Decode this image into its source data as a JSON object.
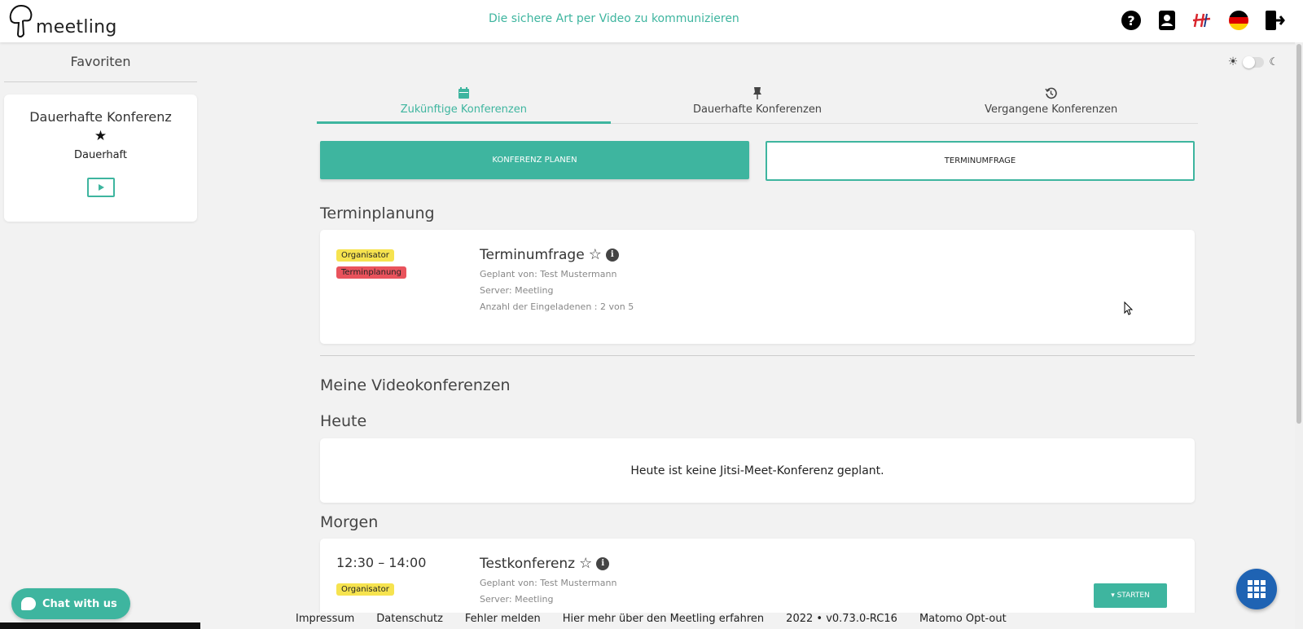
{
  "app": {
    "logo_text": "meetling",
    "tagline": "Die sichere Art per Video zu kommunizieren"
  },
  "header_icons": [
    "help-icon",
    "contacts-icon",
    "brand-icon",
    "german-flag-icon",
    "logout-icon"
  ],
  "sidebar": {
    "title": "Favoriten",
    "favorite": {
      "title": "Dauerhafte Konferenz",
      "subtitle": "Dauerhaft"
    }
  },
  "tabs": [
    {
      "label": "Zukünftige Konferenzen",
      "icon": "calendar-icon",
      "active": true
    },
    {
      "label": "Dauerhafte Konferenzen",
      "icon": "pin-icon",
      "active": false
    },
    {
      "label": "Vergangene Konferenzen",
      "icon": "history-icon",
      "active": false
    }
  ],
  "actions": {
    "plan_label": "KONFERENZ PLANEN",
    "poll_label": "TERMINUMFRAGE"
  },
  "scheduling": {
    "section_title": "Terminplanung",
    "card": {
      "badge_role": "Organisator",
      "badge_type": "Terminplanung",
      "title": "Terminumfrage",
      "planned_by": "Geplant von: Test Mustermann",
      "server": "Server: Meetling",
      "invitees": "Anzahl der Eingeladenen : 2 von 5"
    }
  },
  "my_conferences": {
    "section_title": "Meine Videokonferenzen",
    "today": {
      "title": "Heute",
      "empty_text": "Heute ist keine Jitsi-Meet-Konferenz geplant."
    },
    "tomorrow": {
      "title": "Morgen",
      "card": {
        "time": "12:30 – 14:00",
        "badge_role": "Organisator",
        "title": "Testkonferenz",
        "planned_by": "Geplant von: Test Mustermann",
        "server": "Server: Meetling",
        "start_label": "▾ STARTEN"
      }
    }
  },
  "footer": {
    "links": [
      "Impressum",
      "Datenschutz",
      "Fehler melden",
      "Hier mehr über den Meetling erfahren",
      "2022 • v0.73.0-RC16",
      "Matomo Opt-out"
    ]
  },
  "chat": {
    "label": "Chat with us"
  },
  "colors": {
    "accent": "#3eb59f",
    "yellow_badge": "#f6e34f",
    "red_badge": "#e9535c",
    "apps_button": "#1f63b3"
  }
}
